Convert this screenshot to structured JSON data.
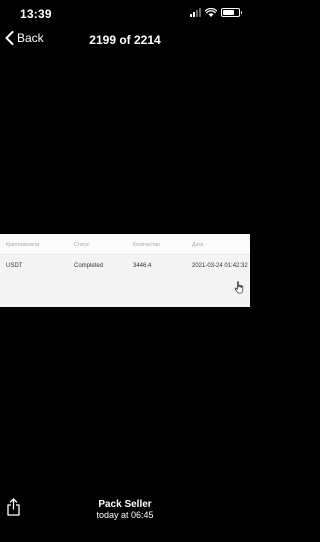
{
  "status_bar": {
    "time": "13:39",
    "icons": [
      "signal-icon",
      "wifi-icon",
      "battery-icon"
    ],
    "signal_bars_active": 2,
    "signal_bars_total": 4,
    "battery_level": 0.7
  },
  "nav": {
    "back_label": "Back",
    "title": "2199 of 2214"
  },
  "photo": {
    "table": {
      "headers": [
        "Криптовалюта",
        "Статус",
        "Количество",
        "Дата"
      ],
      "rows": [
        [
          "USDT",
          "Completed",
          "3446.4",
          "2021-03-24 01:42:32"
        ]
      ]
    }
  },
  "footer": {
    "sender": "Pack Seller",
    "sent_time": "today at 06:45"
  },
  "colors": {
    "background": "#000000",
    "text": "#ffffff",
    "card_background": "#f4f4f4",
    "header_text": "#a8a8a8",
    "cell_text": "#333333"
  }
}
